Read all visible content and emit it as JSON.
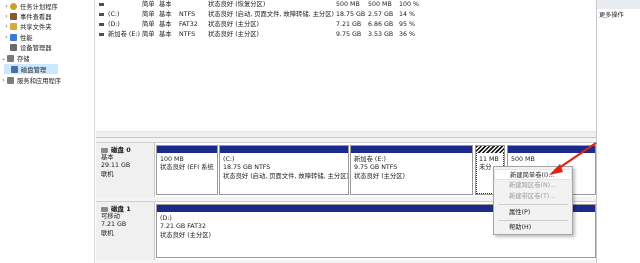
{
  "nav_tree": [
    {
      "label": "任务计划程序",
      "icon": "clock-icon",
      "chevron": "›",
      "color": "#c9a227"
    },
    {
      "label": "事件查看器",
      "icon": "event-viewer-icon",
      "chevron": "›",
      "color": "#8a5a2b"
    },
    {
      "label": "共享文件夹",
      "icon": "shared-folder-icon",
      "chevron": "›",
      "color": "#d6a93a"
    },
    {
      "label": "性能",
      "icon": "performance-icon",
      "chevron": "›",
      "color": "#3b7bd1"
    },
    {
      "label": "设备管理器",
      "icon": "device-manager-icon",
      "chevron": "",
      "color": "#6a6a6a"
    },
    {
      "label": "存储",
      "icon": "storage-icon",
      "chevron": "⌄",
      "color": "#7a7a7a"
    },
    {
      "label": "磁盘管理",
      "icon": "disk-management-icon",
      "chevron": "",
      "color": "#4a6ea8",
      "selected": true
    },
    {
      "label": "服务和应用程序",
      "icon": "services-icon",
      "chevron": "›",
      "color": "#7d7d7d"
    }
  ],
  "volumes": [
    {
      "name": "",
      "layout": "简单",
      "type": "基本",
      "fs": "",
      "status": "状态良好 (恢复分区)",
      "capacity": "500 MB",
      "free": "500 MB",
      "pct": "100 %"
    },
    {
      "name": "(C:)",
      "layout": "简单",
      "type": "基本",
      "fs": "NTFS",
      "status": "状态良好 (启动, 页面文件, 故障转储, 主分区)",
      "capacity": "18.75 GB",
      "free": "2.57 GB",
      "pct": "14 %"
    },
    {
      "name": "(D:)",
      "layout": "简单",
      "type": "基本",
      "fs": "FAT32",
      "status": "状态良好 (主分区)",
      "capacity": "7.21 GB",
      "free": "6.86 GB",
      "pct": "95 %"
    },
    {
      "name": "新加卷 (E:)",
      "layout": "简单",
      "type": "基本",
      "fs": "NTFS",
      "status": "状态良好 (主分区)",
      "capacity": "9.75 GB",
      "free": "3.53 GB",
      "pct": "36 %"
    }
  ],
  "actions_pane": {
    "more_label": "更多操作"
  },
  "disks": [
    {
      "name": "磁盘 0",
      "kind": "基本",
      "size": "29.11 GB",
      "state": "联机",
      "partitions": [
        {
          "title": "",
          "line1": "100 MB",
          "line2": "状态良好 (EFI 系统"
        },
        {
          "title": "(C:)",
          "line1": "18.75 GB NTFS",
          "line2": "状态良好 (启动, 页面文件, 故障转储, 主分区)"
        },
        {
          "title": "新加卷 (E:)",
          "line1": "9.75 GB NTFS",
          "line2": "状态良好 (主分区)"
        },
        {
          "title": "",
          "line1": "11 MB",
          "line2": "未分"
        },
        {
          "title": "",
          "line1": "500 MB",
          "line2": ""
        }
      ]
    },
    {
      "name": "磁盘 1",
      "kind": "可移动",
      "size": "7.21 GB",
      "state": "联机",
      "partitions": [
        {
          "title": "(D:)",
          "line1": "7.21 GB FAT32",
          "line2": "状态良好 (主分区)"
        }
      ]
    }
  ],
  "context_menu": {
    "items": [
      {
        "label": "新建简单卷(I)...",
        "enabled": true
      },
      {
        "label": "新建跨区卷(N)...",
        "enabled": false
      },
      {
        "label": "新建带区卷(T)...",
        "enabled": false
      },
      {
        "label": "属性(P)",
        "enabled": true
      },
      {
        "label": "帮助(H)",
        "enabled": true
      }
    ]
  },
  "colors": {
    "partition_bar": "#1c2a8c",
    "selection": "#cce8ff",
    "arrow": "#e0201b"
  }
}
